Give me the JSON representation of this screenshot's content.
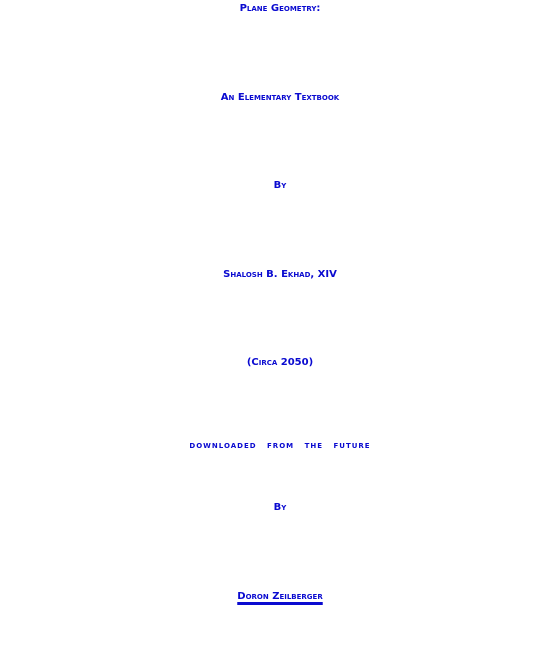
{
  "title_line": "Plane Geometry:",
  "subtitle_line": "An Elementary Textbook",
  "by_1": "By",
  "author_line": "Shalosh B. Ekhad, XIV",
  "date_line": "(Circa 2050)",
  "downloaded_line": "downloaded from the future",
  "by_2": "By",
  "translator_link": "Doron Zeilberger",
  "colors": {
    "text": "#0a0ad0",
    "background": "#ffffff"
  }
}
